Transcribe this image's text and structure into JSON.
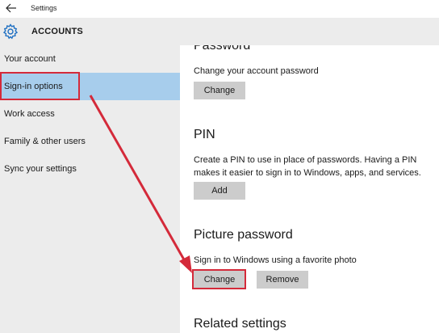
{
  "window": {
    "title": "Settings"
  },
  "header": {
    "title": "ACCOUNTS"
  },
  "sidebar": {
    "items": [
      {
        "label": "Your account"
      },
      {
        "label": "Sign-in options",
        "selected": true
      },
      {
        "label": "Work access"
      },
      {
        "label": "Family & other users"
      },
      {
        "label": "Sync your settings"
      }
    ]
  },
  "password": {
    "title": "Password",
    "description": "Change your account password",
    "change_label": "Change"
  },
  "pin": {
    "title": "PIN",
    "description": "Create a PIN to use in place of passwords. Having a PIN makes it easier to sign in to Windows, apps, and services.",
    "add_label": "Add"
  },
  "picture_password": {
    "title": "Picture password",
    "description": "Sign in to Windows using a favorite photo",
    "change_label": "Change",
    "remove_label": "Remove"
  },
  "related": {
    "title": "Related settings"
  },
  "colors": {
    "accent_highlight": "#d42a3a",
    "selected_nav": "#a7cdec",
    "button_bg": "#cccccc",
    "sidebar_bg": "#ececec"
  },
  "icons": {
    "back": "back-arrow-icon",
    "settings": "gear-icon"
  }
}
